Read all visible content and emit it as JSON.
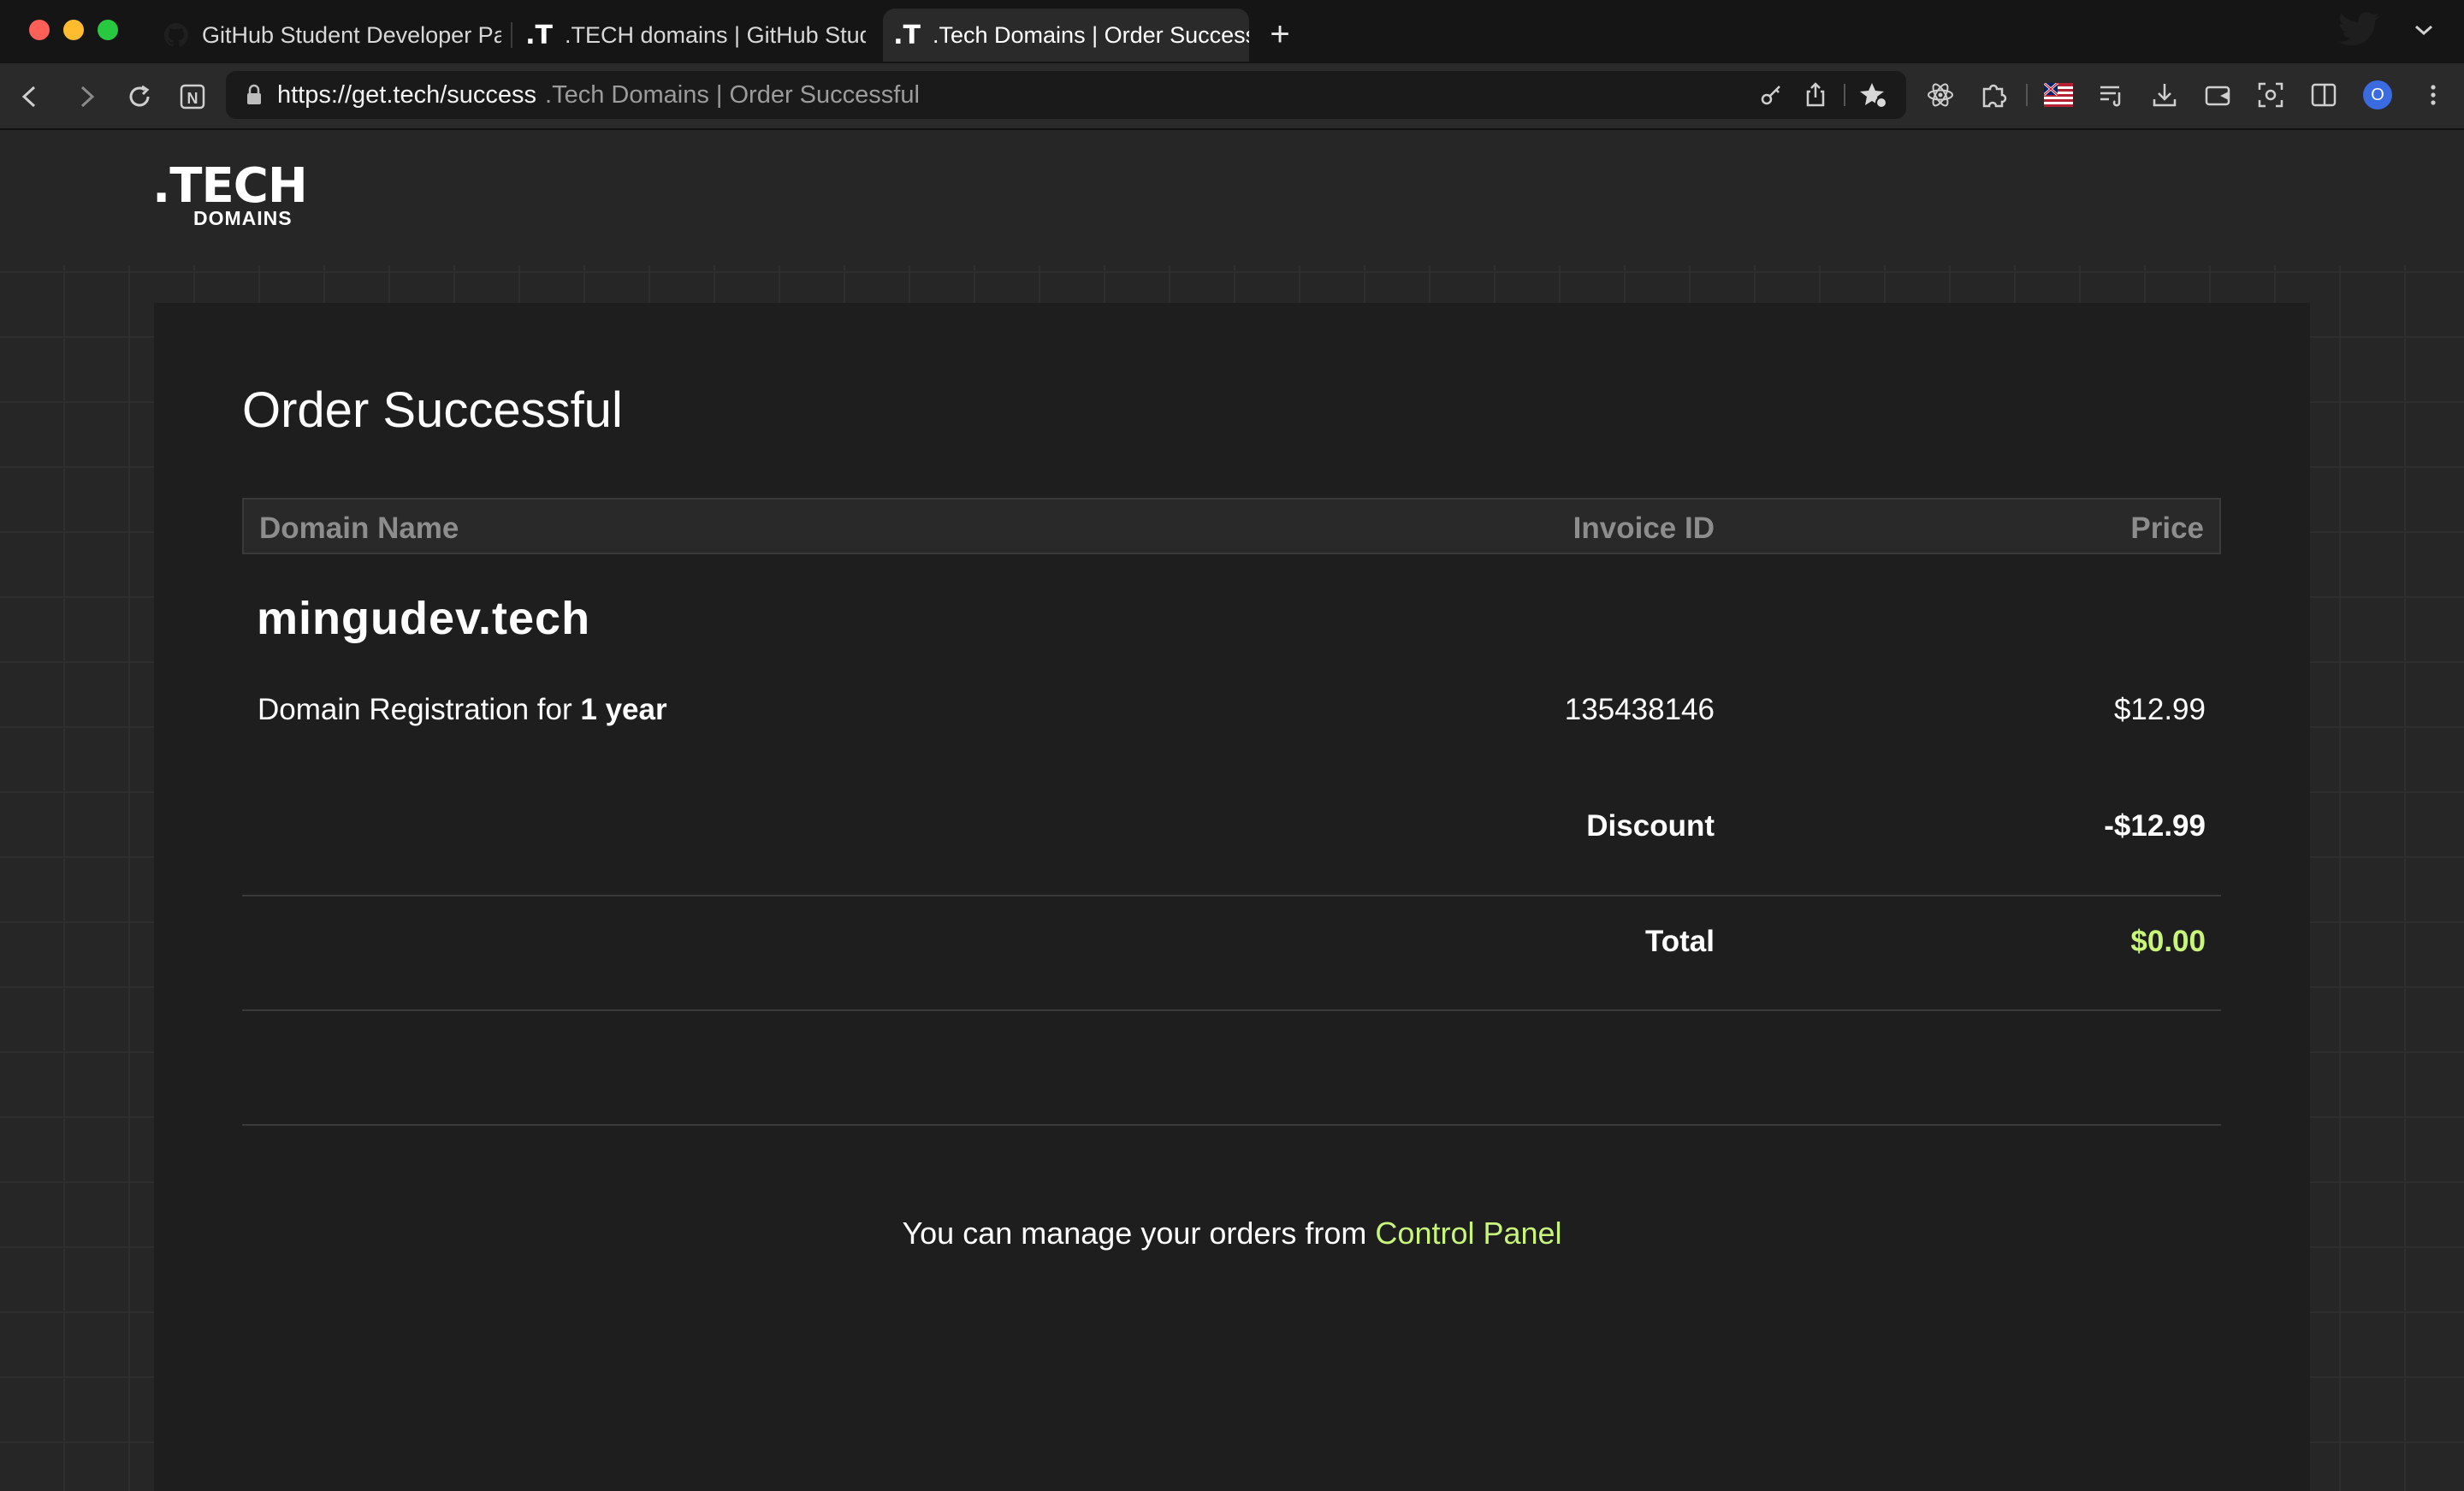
{
  "browser": {
    "tabs": [
      {
        "label": "GitHub Student Developer Pack",
        "icon": "github-icon"
      },
      {
        "label": ".TECH domains | GitHub Student Developer Pack",
        "icon": "tech-logo-icon"
      },
      {
        "label": ".Tech Domains | Order Successful",
        "icon": "tech-logo-icon",
        "active": true
      }
    ],
    "new_tab": "+",
    "url": "https://get.tech/success",
    "page_title": ".Tech Domains | Order Successful",
    "profile_initial": "O"
  },
  "logo": {
    "main": ".TECH",
    "sub": "DOMAINS"
  },
  "order": {
    "heading": "Order Successful",
    "columns": {
      "domain": "Domain Name",
      "invoice": "Invoice ID",
      "price": "Price"
    },
    "domain_name": "mingudev.tech",
    "line_item": {
      "description_prefix": "Domain Registration for ",
      "description_term": "1 year",
      "invoice_id": "135438146",
      "price": "$12.99"
    },
    "discount": {
      "label": "Discount",
      "value": "-$12.99"
    },
    "total": {
      "label": "Total",
      "value": "$0.00"
    },
    "footer_text": "You can manage your orders from ",
    "footer_link": "Control Panel"
  },
  "colors": {
    "accent": "#c8f57a",
    "card": "#1e1e1e",
    "background": "#262626"
  }
}
